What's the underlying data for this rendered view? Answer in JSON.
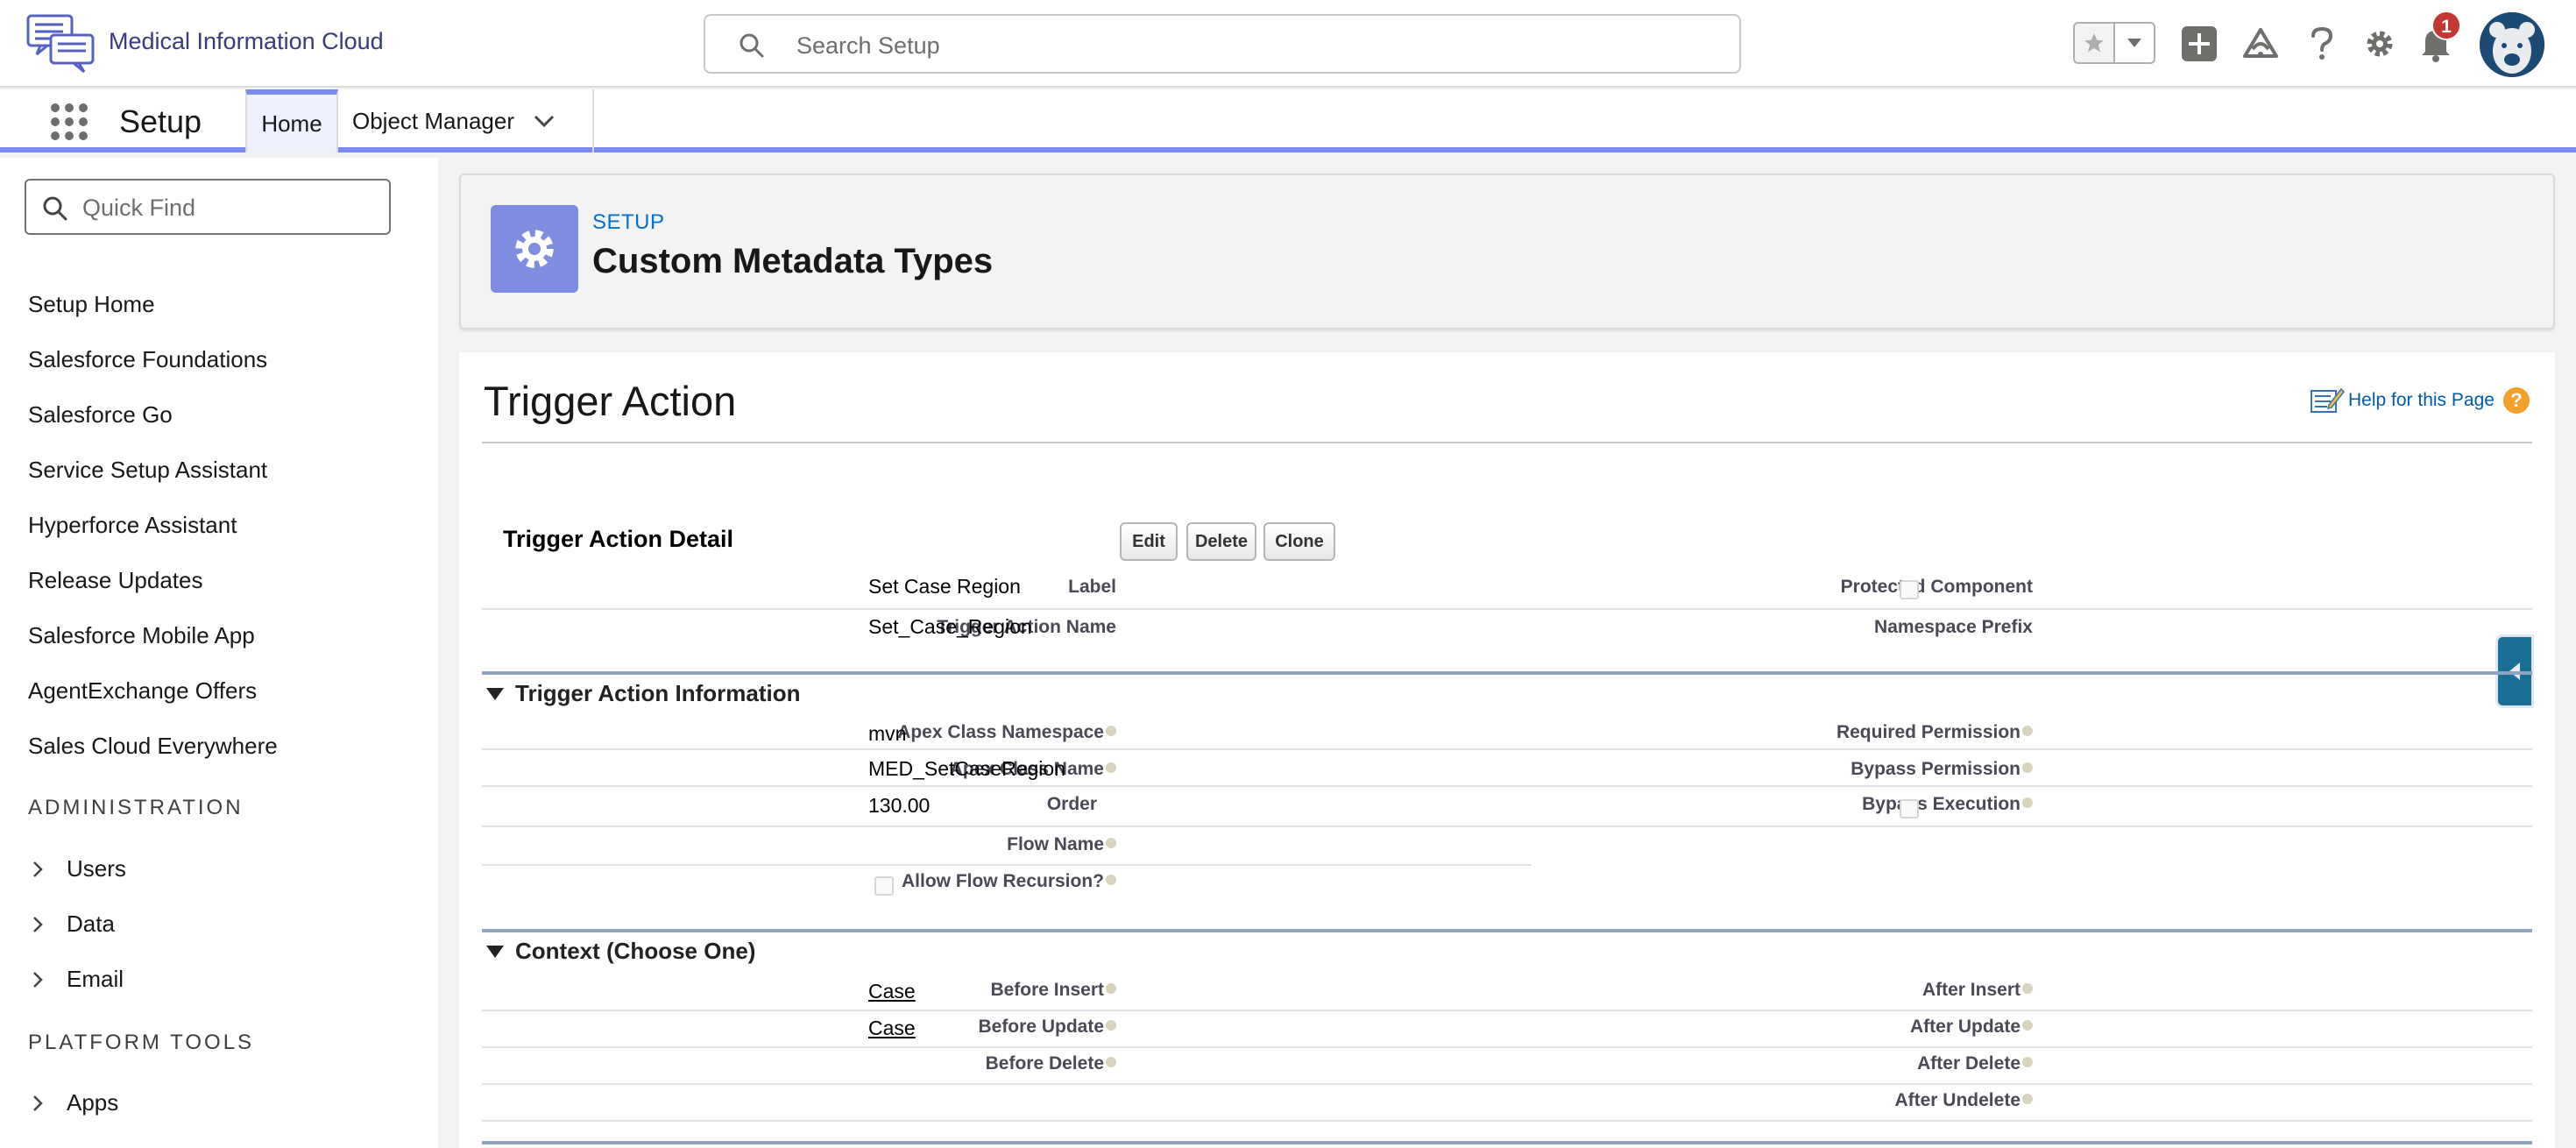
{
  "header": {
    "org_name": "Medical Information Cloud",
    "search_placeholder": "Search Setup",
    "notification_count": "1"
  },
  "context_nav": {
    "app_name": "Setup",
    "tabs": [
      {
        "label": "Home",
        "active": true
      },
      {
        "label": "Object Manager",
        "active": false
      }
    ]
  },
  "sidebar": {
    "quickfind_placeholder": "Quick Find",
    "links": [
      "Setup Home",
      "Salesforce Foundations",
      "Salesforce Go",
      "Service Setup Assistant",
      "Hyperforce Assistant",
      "Release Updates",
      "Salesforce Mobile App",
      "AgentExchange Offers",
      "Sales Cloud Everywhere"
    ],
    "sections": [
      {
        "title": "ADMINISTRATION",
        "items": [
          "Users",
          "Data",
          "Email"
        ]
      },
      {
        "title": "PLATFORM TOOLS",
        "items": [
          "Apps"
        ]
      }
    ]
  },
  "page_header": {
    "eyebrow": "SETUP",
    "title": "Custom Metadata Types"
  },
  "detail": {
    "title": "Trigger Action",
    "help_link": "Help for this Page",
    "block_title": "Trigger Action Detail",
    "buttons": {
      "edit": "Edit",
      "delete": "Delete",
      "clone": "Clone"
    },
    "fields": {
      "label_l": "Label",
      "label_v": "Set Case Region",
      "protected_l": "Protected Component",
      "protected_checked": false,
      "name_l": "Trigger Action Name",
      "name_v": "Set_Case_Region",
      "ns_prefix_l": "Namespace Prefix",
      "ns_prefix_v": ""
    },
    "info_section": {
      "title": "Trigger Action Information",
      "apex_ns_l": "Apex Class Namespace",
      "apex_ns_v": "mvn",
      "apex_name_l": "Apex Class Name",
      "apex_name_v": "MED_SetCaseRegion",
      "order_l": "Order",
      "order_v": "130.00",
      "flow_name_l": "Flow Name",
      "flow_name_v": "",
      "allow_flow_l": "Allow Flow Recursion?",
      "allow_flow_checked": false,
      "req_perm_l": "Required Permission",
      "bypass_perm_l": "Bypass Permission",
      "bypass_exec_l": "Bypass Execution",
      "bypass_exec_checked": false
    },
    "context_section": {
      "title": "Context (Choose One)",
      "before_insert_l": "Before Insert",
      "before_insert_v": "Case",
      "before_update_l": "Before Update",
      "before_update_v": "Case",
      "before_delete_l": "Before Delete",
      "after_insert_l": "After Insert",
      "after_update_l": "After Update",
      "after_delete_l": "After Delete",
      "after_undelete_l": "After Undelete"
    }
  },
  "colors": {
    "brand_accent": "#7a8cf0",
    "link": "#0070d2",
    "badge": "#c23934",
    "section_rule": "#8ea4c0"
  }
}
